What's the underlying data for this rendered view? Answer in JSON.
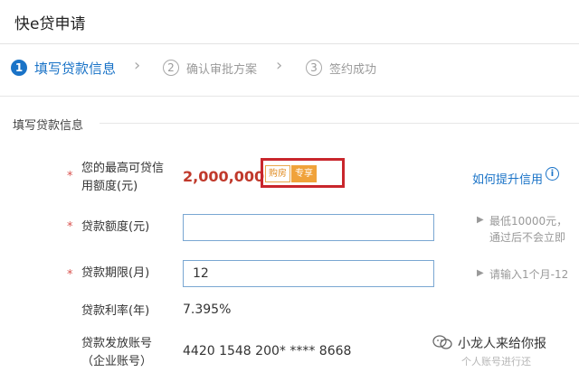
{
  "header": {
    "title": "快e贷申请"
  },
  "steps": [
    {
      "num": "1",
      "label": "填写贷款信息"
    },
    {
      "num": "2",
      "label": "确认审批方案"
    },
    {
      "num": "3",
      "label": "签约成功"
    }
  ],
  "section": {
    "title": "填写贷款信息"
  },
  "max_credit": {
    "label_line1": "您的最高可贷信",
    "label_line2": "用额度(元)",
    "value": "2,000,000.00",
    "badge_a": "购房",
    "badge_b": "专享",
    "help_link": "如何提升信用",
    "info_glyph": "i"
  },
  "loan_amount": {
    "label": "贷款额度(元)",
    "value": "",
    "hint_line1": "最低10000元，",
    "hint_line2": "通过后不会立即"
  },
  "loan_term": {
    "label": "贷款期限(月)",
    "value": "12",
    "hint": "请输入1个月-12"
  },
  "interest_rate": {
    "label": "贷款利率(年)",
    "value": "7.395%"
  },
  "account": {
    "label_line1": "贷款发放账号",
    "label_line2": "（企业账号）",
    "value": "4420 1548 200* **** 8668"
  },
  "watermark": {
    "line1": "小龙人来给你报",
    "line2": "个人账号进行还"
  },
  "colors": {
    "accent": "#1a73c7",
    "amount": "#c0392b",
    "highlight_box": "#c9262c",
    "badge": "#f0a23a"
  },
  "icons": {
    "chevron": "›",
    "hint_arrow": "▶"
  }
}
